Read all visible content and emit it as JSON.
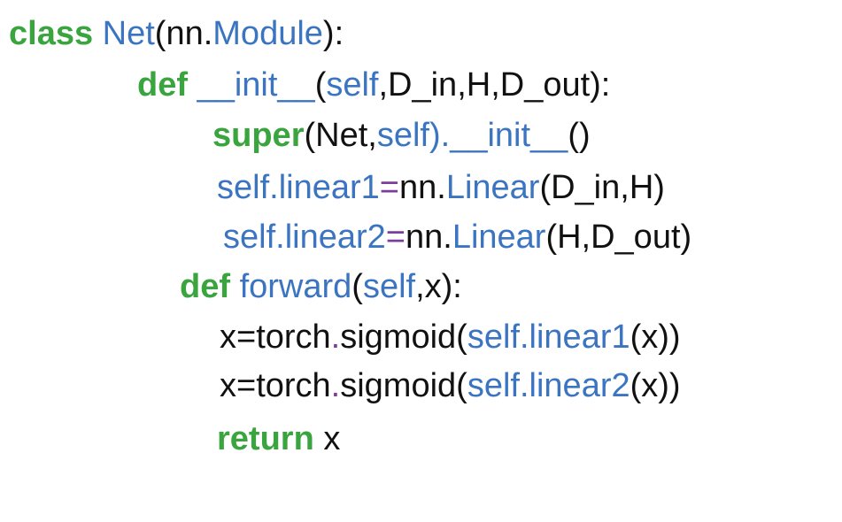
{
  "colors": {
    "keyword": "#3aa43f",
    "identifier": "#3b74c0",
    "plain": "#111111",
    "operator": "#7d3d9a",
    "background": "#ffffff"
  },
  "code": {
    "lines": [
      {
        "tokens": [
          {
            "t": "class",
            "k": "kw"
          },
          {
            "t": " ",
            "k": "plain"
          },
          {
            "t": "Net",
            "k": "cls"
          },
          {
            "t": "(nn.",
            "k": "plain"
          },
          {
            "t": "Module",
            "k": "cls"
          },
          {
            "t": "):",
            "k": "plain"
          }
        ]
      },
      {
        "tokens": [
          {
            "t": "def",
            "k": "kw"
          },
          {
            "t": " ",
            "k": "plain"
          },
          {
            "t": "__init__",
            "k": "fn"
          },
          {
            "t": "(",
            "k": "plain"
          },
          {
            "t": "self",
            "k": "self"
          },
          {
            "t": ",D_in,H,D_out):",
            "k": "plain"
          }
        ]
      },
      {
        "tokens": [
          {
            "t": "super",
            "k": "kw"
          },
          {
            "t": "(Net,",
            "k": "plain"
          },
          {
            "t": "self",
            "k": "self"
          },
          {
            "t": ").__init__",
            "k": "fn"
          },
          {
            "t": "()",
            "k": "plain"
          }
        ]
      },
      {
        "tokens": [
          {
            "t": "self",
            "k": "self"
          },
          {
            "t": ".linear1",
            "k": "fn"
          },
          {
            "t": "=",
            "k": "op"
          },
          {
            "t": "nn.",
            "k": "plain"
          },
          {
            "t": "Linear",
            "k": "cls"
          },
          {
            "t": "(D_in,H)",
            "k": "plain"
          }
        ]
      },
      {
        "tokens": [
          {
            "t": "self",
            "k": "self"
          },
          {
            "t": ".linear2",
            "k": "fn"
          },
          {
            "t": "=",
            "k": "op"
          },
          {
            "t": "nn.",
            "k": "plain"
          },
          {
            "t": "Linear",
            "k": "cls"
          },
          {
            "t": "(H,D_out)",
            "k": "plain"
          }
        ]
      },
      {
        "tokens": [
          {
            "t": "def",
            "k": "kw"
          },
          {
            "t": " ",
            "k": "plain"
          },
          {
            "t": "forward",
            "k": "fn"
          },
          {
            "t": "(",
            "k": "plain"
          },
          {
            "t": "self",
            "k": "self"
          },
          {
            "t": ",x):",
            "k": "plain"
          }
        ]
      },
      {
        "tokens": [
          {
            "t": "x=torch",
            "k": "plain"
          },
          {
            "t": ".",
            "k": "op"
          },
          {
            "t": "sigmoid(",
            "k": "plain"
          },
          {
            "t": "self",
            "k": "self"
          },
          {
            "t": ".linear1",
            "k": "fn"
          },
          {
            "t": "(x))",
            "k": "plain"
          }
        ]
      },
      {
        "tokens": [
          {
            "t": "x=torch",
            "k": "plain"
          },
          {
            "t": ".",
            "k": "op"
          },
          {
            "t": "sigmoid(",
            "k": "plain"
          },
          {
            "t": "self",
            "k": "self"
          },
          {
            "t": ".linear2",
            "k": "fn"
          },
          {
            "t": "(x))",
            "k": "plain"
          }
        ]
      },
      {
        "tokens": [
          {
            "t": "return",
            "k": "kw"
          },
          {
            "t": " x",
            "k": "plain"
          }
        ]
      }
    ]
  }
}
